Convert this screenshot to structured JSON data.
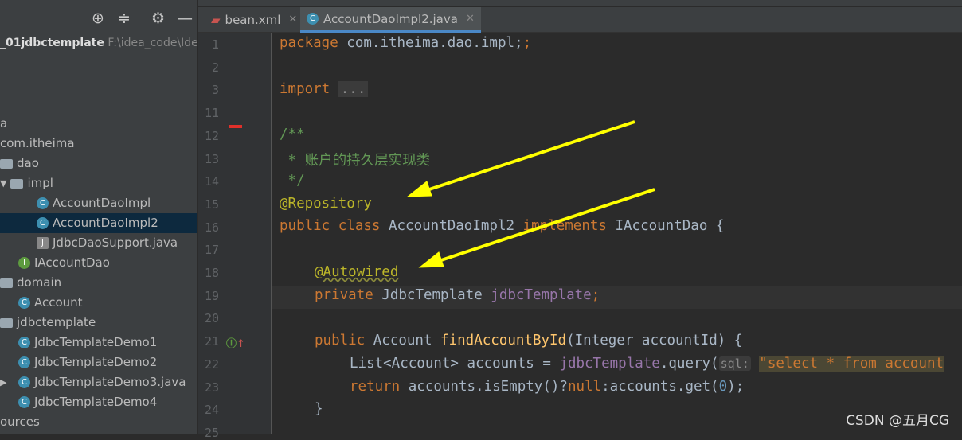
{
  "sidebar": {
    "project_name": "_01jdbctemplate",
    "project_path": "F:\\idea_code\\Ide",
    "items": [
      {
        "label": "a"
      },
      {
        "label": "com.itheima"
      },
      {
        "label": "dao"
      },
      {
        "label": "impl"
      },
      {
        "label": "AccountDaoImpl"
      },
      {
        "label": "AccountDaoImpl2"
      },
      {
        "label": "JdbcDaoSupport.java"
      },
      {
        "label": "IAccountDao"
      },
      {
        "label": "domain"
      },
      {
        "label": "Account"
      },
      {
        "label": "jdbctemplate"
      },
      {
        "label": "JdbcTemplateDemo1"
      },
      {
        "label": "JdbcTemplateDemo2"
      },
      {
        "label": "JdbcTemplateDemo3.java"
      },
      {
        "label": "JdbcTemplateDemo4"
      },
      {
        "label": "ources"
      }
    ]
  },
  "tabs": [
    {
      "label": "bean.xml"
    },
    {
      "label": "AccountDaoImpl2.java",
      "active": true
    }
  ],
  "editor": {
    "line_numbers": [
      "1",
      "2",
      "3",
      "11",
      "12",
      "13",
      "14",
      "15",
      "16",
      "17",
      "18",
      "19",
      "20",
      "21",
      "22",
      "23",
      "24",
      "25"
    ],
    "l1a": "package",
    "l1b": " com.itheima.dao.impl;",
    "l3a": "import",
    "l3b": "...",
    "l12": "/**",
    "l13": " * 账户的持久层实现类",
    "l14": " */",
    "l15": "@Repository",
    "l16a": "public class",
    "l16b": " AccountDaoImpl2 ",
    "l16c": "implements",
    "l16d": " IAccountDao {",
    "l18": "@Autowired",
    "l19a": "private",
    "l19b": " JdbcTemplate ",
    "l19c": "jdbcTemplate",
    "l19d": ";",
    "l21a": "public",
    "l21b": " Account ",
    "l21c": "findAccountById",
    "l21d": "(Integer accountId) {",
    "l22a": "List<Account> accounts = ",
    "l22b": "jdbcTemplate",
    "l22c": ".query(",
    "l22d": "sql:",
    "l22e": "\"select * from account",
    "l23a": "return",
    "l23b": " accounts.isEmpty()?",
    "l23c": "null",
    "l23d": ":accounts.get(",
    "l23e": "0",
    "l23f": ");",
    "l24": "}"
  },
  "watermark": "CSDN @五月CG",
  "colors": {
    "arrow": "#ffff00",
    "keyword": "#cc7832",
    "annotation": "#bbb529",
    "comment": "#629755"
  }
}
